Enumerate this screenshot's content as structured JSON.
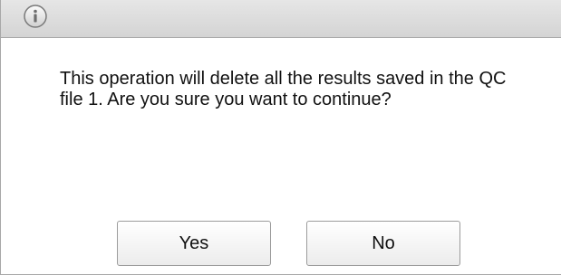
{
  "dialog": {
    "icon": "info-icon",
    "message": "This operation will delete all the results saved in the QC file 1. Are you sure you want to continue?",
    "buttons": {
      "yes_label": "Yes",
      "no_label": "No"
    }
  }
}
